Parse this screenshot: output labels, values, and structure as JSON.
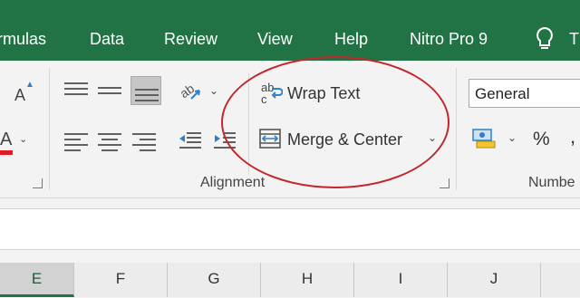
{
  "tabs": [
    {
      "id": "formulas",
      "label": "rmulas"
    },
    {
      "id": "data",
      "label": "Data"
    },
    {
      "id": "review",
      "label": "Review"
    },
    {
      "id": "view",
      "label": "View"
    },
    {
      "id": "help",
      "label": "Help"
    },
    {
      "id": "nitro",
      "label": "Nitro Pro 9"
    },
    {
      "id": "tellme",
      "label": "T"
    }
  ],
  "font": {
    "size_glyph": "A",
    "color_glyph": "A"
  },
  "alignment": {
    "group_label": "Alignment",
    "wrap_text": {
      "icon_text_top": "ab",
      "icon_text_bottom": "c",
      "label": "Wrap Text"
    },
    "merge_center": {
      "label": "Merge & Center"
    }
  },
  "number": {
    "format": "General",
    "percent": "%",
    "comma": ",",
    "group_label": "Numbe"
  },
  "columns": [
    "E",
    "F",
    "G",
    "H",
    "I",
    "J"
  ],
  "colors": {
    "ribbon_green": "#217346",
    "annotation_red": "#c3262b",
    "font_color_bar": "#e21b23"
  }
}
